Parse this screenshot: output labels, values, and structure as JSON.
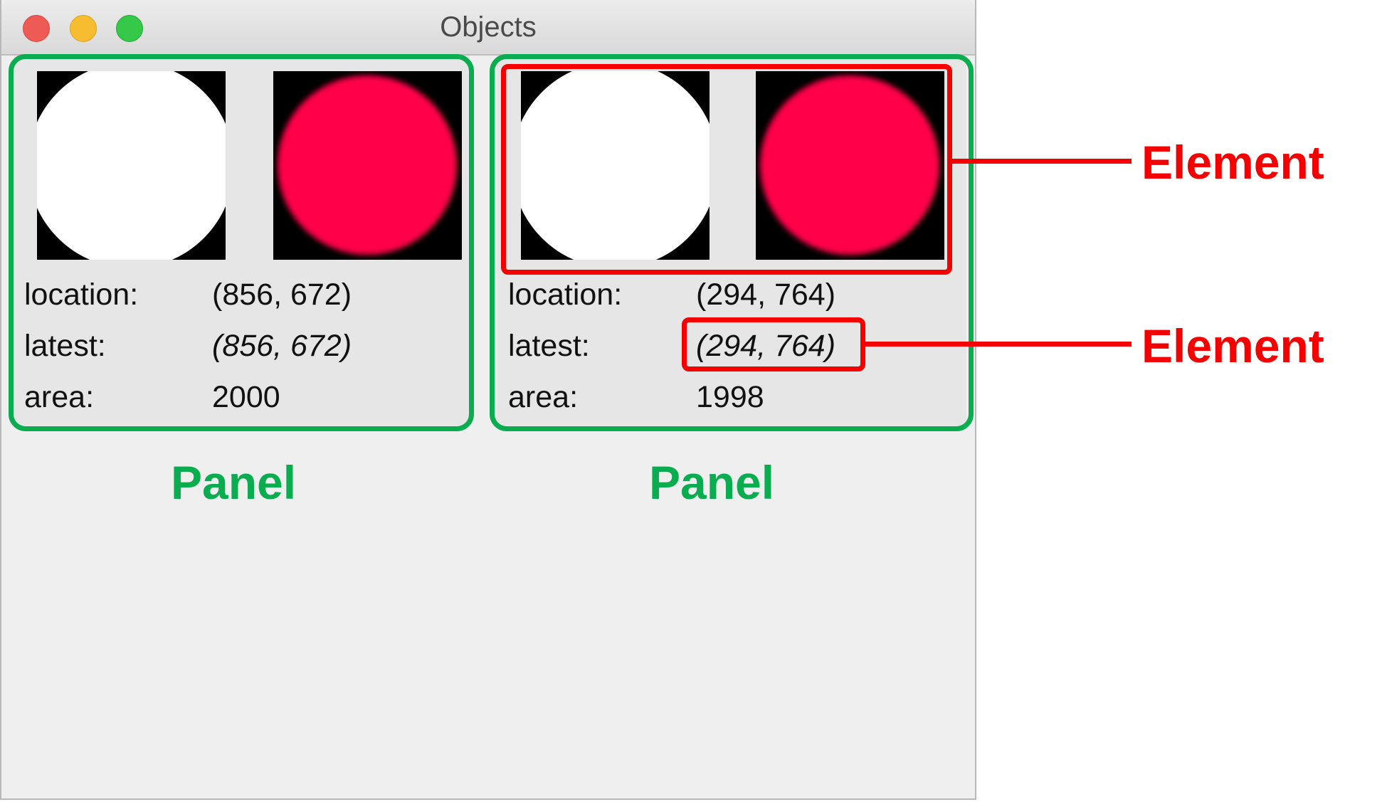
{
  "window": {
    "title": "Objects"
  },
  "panels": [
    {
      "rows": [
        {
          "label": "location:",
          "value": "(856, 672)"
        },
        {
          "label": "latest:",
          "value": "(856, 672)"
        },
        {
          "label": "area:",
          "value": "2000"
        }
      ],
      "circle_colors": {
        "mask": "#ffffff",
        "blob": "#ff0048"
      }
    },
    {
      "rows": [
        {
          "label": "location:",
          "value": "(294, 764)"
        },
        {
          "label": "latest:",
          "value": "(294, 764)"
        },
        {
          "label": "area:",
          "value": "1998"
        }
      ],
      "circle_colors": {
        "mask": "#ffffff",
        "blob": "#ff0048"
      }
    }
  ],
  "annotations": {
    "panel_label": "Panel",
    "element_label": "Element",
    "panel_color": "#0aac50",
    "element_color": "#f40000"
  }
}
